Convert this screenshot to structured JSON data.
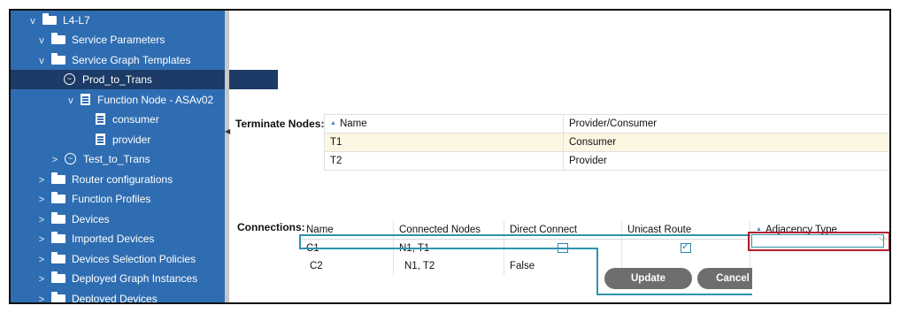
{
  "sidebar": {
    "items": [
      {
        "label": "L4-L7",
        "icon": "folder-icon",
        "chevron": "v"
      },
      {
        "label": "Service Parameters",
        "icon": "folder-icon",
        "chevron": "v"
      },
      {
        "label": "Service Graph Templates",
        "icon": "folder-icon",
        "chevron": "v"
      },
      {
        "label": "Prod_to_Trans",
        "icon": "graph-template-icon",
        "chevron": ""
      },
      {
        "label": "Function Node - ASAv02",
        "icon": "document-icon",
        "chevron": "v"
      },
      {
        "label": "consumer",
        "icon": "document-icon",
        "chevron": ""
      },
      {
        "label": "provider",
        "icon": "document-icon",
        "chevron": ""
      },
      {
        "label": "Test_to_Trans",
        "icon": "graph-template-icon",
        "chevron": ">"
      },
      {
        "label": "Router configurations",
        "icon": "folder-icon",
        "chevron": ">"
      },
      {
        "label": "Function Profiles",
        "icon": "folder-icon",
        "chevron": ">"
      },
      {
        "label": "Devices",
        "icon": "folder-icon",
        "chevron": ">"
      },
      {
        "label": "Imported Devices",
        "icon": "folder-icon",
        "chevron": ">"
      },
      {
        "label": "Devices Selection Policies",
        "icon": "folder-icon",
        "chevron": ">"
      },
      {
        "label": "Deployed Graph Instances",
        "icon": "folder-icon",
        "chevron": ">"
      },
      {
        "label": "Deployed Devices",
        "icon": "folder-icon",
        "chevron": ">"
      }
    ]
  },
  "terminate": {
    "label": "Terminate Nodes:",
    "columns": [
      "Name",
      "Provider/Consumer"
    ],
    "rows": [
      [
        "T1",
        "Consumer"
      ],
      [
        "T2",
        "Provider"
      ]
    ]
  },
  "connections": {
    "label": "Connections:",
    "columns": [
      "Name",
      "Connected Nodes",
      "Direct Connect",
      "Unicast Route",
      "Adjacency Type"
    ],
    "rows": [
      {
        "name": "C1",
        "nodes": "N1, T1",
        "direct": "",
        "unicast": "",
        "direct_checked": false,
        "unicast_checked": true
      },
      {
        "name": "C2",
        "nodes": "N1, T2",
        "direct": "False",
        "unicast": ""
      }
    ],
    "adjacency_value": ""
  },
  "buttons": {
    "update": "Update",
    "cancel": "Cancel"
  },
  "colors": {
    "sidebar_bg": "#2f6db2",
    "selected_bg": "#1c3b66",
    "edit_outline": "#2e93b0",
    "highlight": "#b3202f",
    "button_bg": "#6e6e6e"
  }
}
